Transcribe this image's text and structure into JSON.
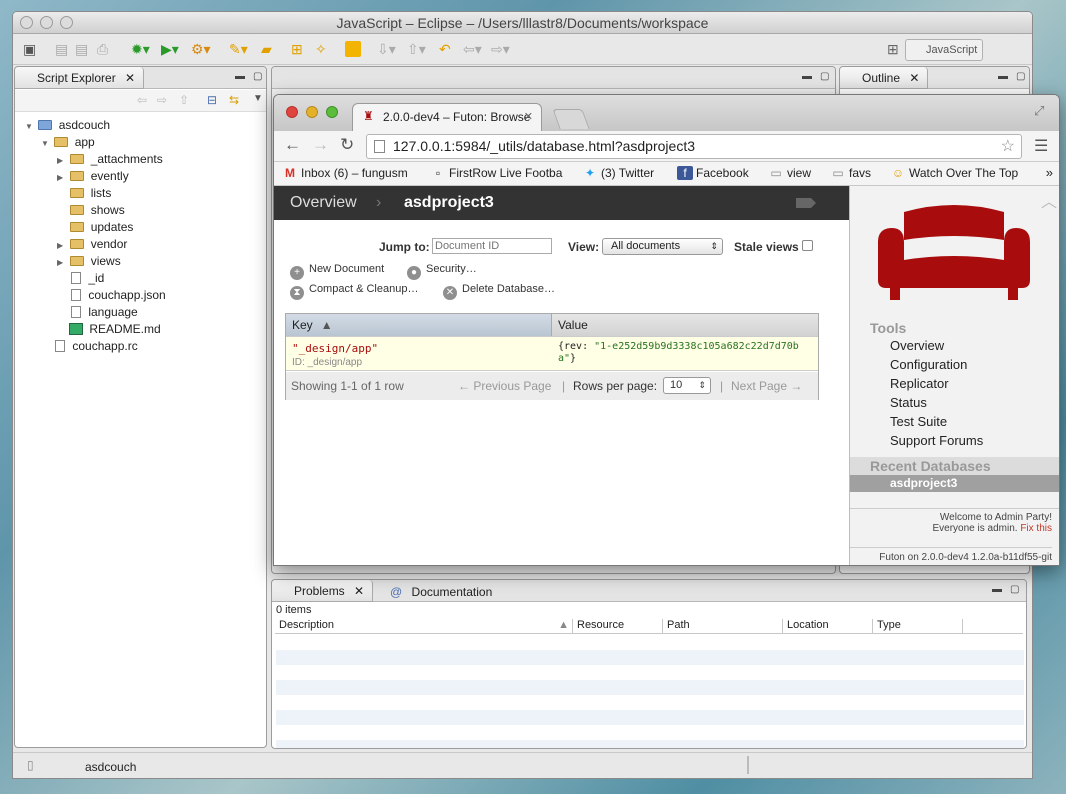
{
  "eclipse": {
    "title": "JavaScript – Eclipse – /Users/lllastr8/Documents/workspace",
    "perspective": "JavaScript",
    "status_item": "asdcouch"
  },
  "script_explorer": {
    "tab": "Script Explorer",
    "tree": [
      {
        "label": "asdcouch",
        "level": 0,
        "kind": "project"
      },
      {
        "label": "app",
        "level": 1,
        "kind": "folder"
      },
      {
        "label": "_attachments",
        "level": 2,
        "kind": "folder"
      },
      {
        "label": "evently",
        "level": 2,
        "kind": "folder"
      },
      {
        "label": "lists",
        "level": 2,
        "kind": "folder"
      },
      {
        "label": "shows",
        "level": 2,
        "kind": "folder"
      },
      {
        "label": "updates",
        "level": 2,
        "kind": "folder"
      },
      {
        "label": "vendor",
        "level": 2,
        "kind": "folder"
      },
      {
        "label": "views",
        "level": 2,
        "kind": "folder"
      },
      {
        "label": "_id",
        "level": 2,
        "kind": "file"
      },
      {
        "label": "couchapp.json",
        "level": 2,
        "kind": "file"
      },
      {
        "label": "language",
        "level": 2,
        "kind": "file"
      },
      {
        "label": "README.md",
        "level": 2,
        "kind": "file"
      },
      {
        "label": "couchapp.rc",
        "level": 1,
        "kind": "file"
      }
    ]
  },
  "outline": {
    "tab": "Outline"
  },
  "problems": {
    "tab": "Problems",
    "tab2": "Documentation",
    "count": "0 items",
    "columns": [
      "Description",
      "Resource",
      "Path",
      "Location",
      "Type"
    ]
  },
  "browser": {
    "tab_title": "2.0.0-dev4 – Futon: Browse",
    "url": "127.0.0.1:5984/_utils/database.html?asdproject3",
    "bookmarks": [
      "Inbox (6) – fungusm",
      "FirstRow Live Footba",
      "(3) Twitter",
      "Facebook",
      "view",
      "favs",
      "Watch Over The Top"
    ]
  },
  "futon": {
    "breadcrumb": [
      "Overview",
      "asdproject3"
    ],
    "jump_label": "Jump to:",
    "jump_placeholder": "Document ID",
    "view_label": "View:",
    "view_value": "All documents",
    "stale_label": "Stale views",
    "actions": [
      "New Document",
      "Security…",
      "Compact & Cleanup…",
      "Delete Database…"
    ],
    "table": {
      "headers": [
        "Key",
        "Value"
      ],
      "rows": [
        {
          "key": "\"_design/app\"",
          "id": "ID: _design/app",
          "value_prefix": "{rev: ",
          "value_str": "\"1-e252d59b9d3338c105a682c22d7d70ba\"",
          "value_suffix": "}"
        }
      ],
      "showing": "Showing 1-1 of 1 row",
      "prev": "← Previous Page",
      "rows_per_page_label": "Rows per page:",
      "rows_per_page": "10",
      "next": "Next Page →"
    },
    "tools_heading": "Tools",
    "tools": [
      "Overview",
      "Configuration",
      "Replicator",
      "Status",
      "Test Suite",
      "Support Forums"
    ],
    "recent_heading": "Recent Databases",
    "recent": [
      "asdproject3"
    ],
    "welcome": "Welcome to Admin Party!",
    "admin": "Everyone is admin.",
    "fix": "Fix this",
    "version": "Futon on 2.0.0-dev4 1.2.0a-b11df55-git",
    "couch_color": "#a80c0c"
  }
}
